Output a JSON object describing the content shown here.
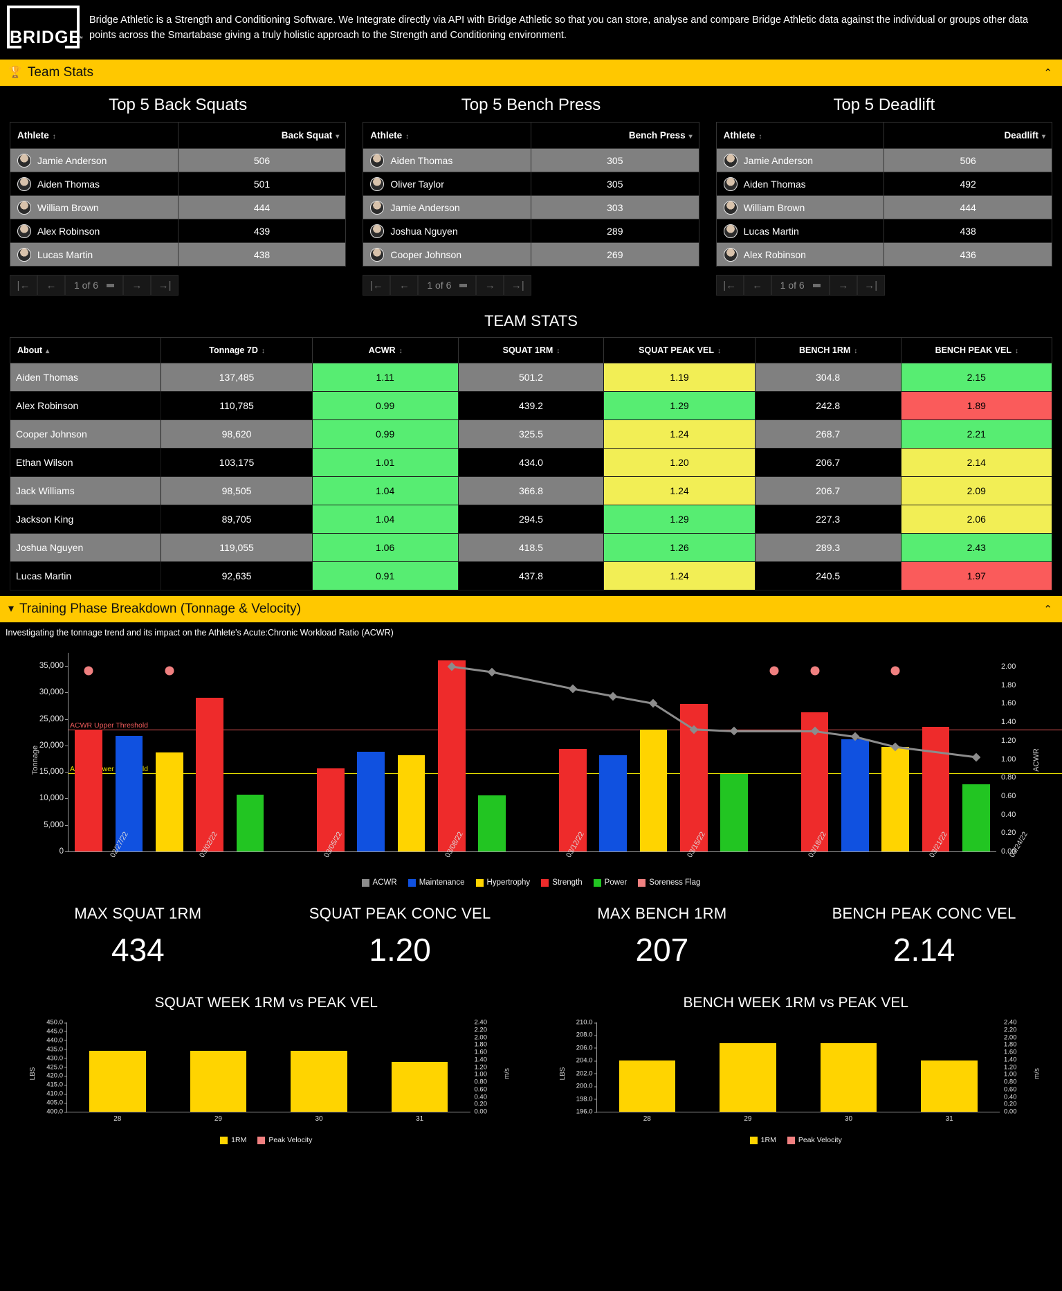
{
  "header": {
    "logo_text": "BRIDGE",
    "logo_tm": "™",
    "intro": "Bridge Athletic is a Strength and Conditioning Software. We Integrate directly via API with Bridge Athletic so that you can store, analyse and compare Bridge Athletic data against the individual or groups other data points across the Smartabase giving a truly holistic approach to the Strength and Conditioning environment."
  },
  "team_stats_section": {
    "icon": "trophy-icon",
    "title": "Team Stats",
    "collapse_caret": "⌃"
  },
  "top5": [
    {
      "title": "Top 5 Back Squats",
      "col_athlete": "Athlete",
      "col_value": "Back Squat",
      "rows": [
        {
          "athlete": "Jamie Anderson",
          "value": "506"
        },
        {
          "athlete": "Aiden Thomas",
          "value": "501"
        },
        {
          "athlete": "William Brown",
          "value": "444"
        },
        {
          "athlete": "Alex Robinson",
          "value": "439"
        },
        {
          "athlete": "Lucas Martin",
          "value": "438"
        }
      ],
      "pager": "1 of 6"
    },
    {
      "title": "Top 5 Bench Press",
      "col_athlete": "Athlete",
      "col_value": "Bench Press",
      "rows": [
        {
          "athlete": "Aiden Thomas",
          "value": "305"
        },
        {
          "athlete": "Oliver Taylor",
          "value": "305"
        },
        {
          "athlete": "Jamie Anderson",
          "value": "303"
        },
        {
          "athlete": "Joshua Nguyen",
          "value": "289"
        },
        {
          "athlete": "Cooper Johnson",
          "value": "269"
        }
      ],
      "pager": "1 of 6"
    },
    {
      "title": "Top 5 Deadlift",
      "col_athlete": "Athlete",
      "col_value": "Deadlift",
      "rows": [
        {
          "athlete": "Jamie Anderson",
          "value": "506"
        },
        {
          "athlete": "Aiden Thomas",
          "value": "492"
        },
        {
          "athlete": "William Brown",
          "value": "444"
        },
        {
          "athlete": "Lucas Martin",
          "value": "438"
        },
        {
          "athlete": "Alex Robinson",
          "value": "436"
        }
      ],
      "pager": "1 of 6"
    }
  ],
  "team_stats_table": {
    "title": "TEAM STATS",
    "columns": [
      "About",
      "Tonnage 7D",
      "ACWR",
      "SQUAT 1RM",
      "SQUAT PEAK VEL",
      "BENCH 1RM",
      "BENCH PEAK VEL"
    ],
    "rows": [
      {
        "about": "Aiden Thomas",
        "tonnage": "137,485",
        "acwr": "1.11",
        "squat_1rm": "501.2",
        "squat_vel": "1.19",
        "bench_1rm": "304.8",
        "bench_vel": "2.15",
        "colors": [
          "grey",
          "grey",
          "green",
          "grey",
          "yellow",
          "grey",
          "green"
        ]
      },
      {
        "about": "Alex Robinson",
        "tonnage": "110,785",
        "acwr": "0.99",
        "squat_1rm": "439.2",
        "squat_vel": "1.29",
        "bench_1rm": "242.8",
        "bench_vel": "1.89",
        "colors": [
          "black",
          "black",
          "green",
          "black",
          "green",
          "black",
          "red"
        ]
      },
      {
        "about": "Cooper Johnson",
        "tonnage": "98,620",
        "acwr": "0.99",
        "squat_1rm": "325.5",
        "squat_vel": "1.24",
        "bench_1rm": "268.7",
        "bench_vel": "2.21",
        "colors": [
          "grey",
          "grey",
          "green",
          "grey",
          "yellow",
          "grey",
          "green"
        ]
      },
      {
        "about": "Ethan Wilson",
        "tonnage": "103,175",
        "acwr": "1.01",
        "squat_1rm": "434.0",
        "squat_vel": "1.20",
        "bench_1rm": "206.7",
        "bench_vel": "2.14",
        "colors": [
          "black",
          "black",
          "green",
          "black",
          "yellow",
          "black",
          "yellow"
        ]
      },
      {
        "about": "Jack Williams",
        "tonnage": "98,505",
        "acwr": "1.04",
        "squat_1rm": "366.8",
        "squat_vel": "1.24",
        "bench_1rm": "206.7",
        "bench_vel": "2.09",
        "colors": [
          "grey",
          "grey",
          "green",
          "grey",
          "yellow",
          "grey",
          "yellow"
        ]
      },
      {
        "about": "Jackson King",
        "tonnage": "89,705",
        "acwr": "1.04",
        "squat_1rm": "294.5",
        "squat_vel": "1.29",
        "bench_1rm": "227.3",
        "bench_vel": "2.06",
        "colors": [
          "black",
          "black",
          "green",
          "black",
          "green",
          "black",
          "yellow"
        ]
      },
      {
        "about": "Joshua Nguyen",
        "tonnage": "119,055",
        "acwr": "1.06",
        "squat_1rm": "418.5",
        "squat_vel": "1.26",
        "bench_1rm": "289.3",
        "bench_vel": "2.43",
        "colors": [
          "grey",
          "grey",
          "green",
          "grey",
          "green",
          "grey",
          "green"
        ]
      },
      {
        "about": "Lucas Martin",
        "tonnage": "92,635",
        "acwr": "0.91",
        "squat_1rm": "437.8",
        "squat_vel": "1.24",
        "bench_1rm": "240.5",
        "bench_vel": "1.97",
        "colors": [
          "black",
          "black",
          "green",
          "black",
          "yellow",
          "black",
          "red"
        ]
      }
    ]
  },
  "training_section": {
    "icon": "filter-icon",
    "title": "Training Phase Breakdown (Tonnage & Velocity)",
    "collapse_caret": "⌃",
    "subtitle": "Investigating  the tonnage trend and its impact on the Athlete's Acute:Chronic Workload Ratio (ACWR)"
  },
  "chart_data": {
    "type": "bar",
    "title": "Training Phase Breakdown (Tonnage & Velocity)",
    "xlabel": "",
    "ylabel": "Tonnage",
    "y2label": "ACWR",
    "ylim": [
      0,
      37500
    ],
    "y2lim": [
      0,
      2.15
    ],
    "yticks": [
      "0",
      "5,000",
      "10,000",
      "15,000",
      "20,000",
      "25,000",
      "30,000",
      "35,000"
    ],
    "y2ticks": [
      "0.00",
      "0.20",
      "0.40",
      "0.60",
      "0.80",
      "1.00",
      "1.20",
      "1.40",
      "1.60",
      "1.80",
      "2.00"
    ],
    "xticks": [
      "02/27/22",
      "03/02/22",
      "03/05/22",
      "03/08/22",
      "03/12/22",
      "03/15/22",
      "03/18/22",
      "03/21/22",
      "03/24/22"
    ],
    "grid": false,
    "legend_position": "bottom",
    "legend": [
      {
        "label": "ACWR",
        "color": "#8C8C8C"
      },
      {
        "label": "Maintenance",
        "color": "#1051E0"
      },
      {
        "label": "Hypertrophy",
        "color": "#FFD400"
      },
      {
        "label": "Strength",
        "color": "#EE2B2B"
      },
      {
        "label": "Power",
        "color": "#22C522"
      },
      {
        "label": "Soreness Flag",
        "color": "#F08080"
      }
    ],
    "thresholds": [
      {
        "label": "ACWR Upper Threshold",
        "value": 23000,
        "color": "#F05B5B"
      },
      {
        "label": "ACWR Lower Threshold",
        "value": 14800,
        "color": "#E8E000"
      }
    ],
    "bars": [
      {
        "x": 0,
        "value": 23000,
        "phase": "Strength"
      },
      {
        "x": 1,
        "value": 21800,
        "phase": "Maintenance"
      },
      {
        "x": 2,
        "value": 18650,
        "phase": "Hypertrophy"
      },
      {
        "x": 3,
        "value": 29000,
        "phase": "Strength"
      },
      {
        "x": 4,
        "value": 10700,
        "phase": "Power"
      },
      {
        "x": 6,
        "value": 15700,
        "phase": "Strength"
      },
      {
        "x": 7,
        "value": 18800,
        "phase": "Maintenance"
      },
      {
        "x": 8,
        "value": 18100,
        "phase": "Hypertrophy"
      },
      {
        "x": 9,
        "value": 36100,
        "phase": "Strength"
      },
      {
        "x": 10,
        "value": 10650,
        "phase": "Power"
      },
      {
        "x": 12,
        "value": 19400,
        "phase": "Strength"
      },
      {
        "x": 13,
        "value": 18200,
        "phase": "Maintenance"
      },
      {
        "x": 14,
        "value": 23000,
        "phase": "Hypertrophy"
      },
      {
        "x": 15,
        "value": 27800,
        "phase": "Strength"
      },
      {
        "x": 16,
        "value": 14700,
        "phase": "Power"
      },
      {
        "x": 18,
        "value": 26300,
        "phase": "Strength"
      },
      {
        "x": 19,
        "value": 21200,
        "phase": "Maintenance"
      },
      {
        "x": 20,
        "value": 19700,
        "phase": "Hypertrophy"
      },
      {
        "x": 21,
        "value": 23500,
        "phase": "Strength"
      },
      {
        "x": 22,
        "value": 12700,
        "phase": "Power"
      }
    ],
    "acwr_line": [
      {
        "x": 9,
        "value": 2.0
      },
      {
        "x": 10,
        "value": 1.94
      },
      {
        "x": 12,
        "value": 1.76
      },
      {
        "x": 13,
        "value": 1.68
      },
      {
        "x": 14,
        "value": 1.6
      },
      {
        "x": 15,
        "value": 1.32
      },
      {
        "x": 16,
        "value": 1.3
      },
      {
        "x": 18,
        "value": 1.3
      },
      {
        "x": 19,
        "value": 1.24
      },
      {
        "x": 20,
        "value": 1.13
      },
      {
        "x": 22,
        "value": 1.02
      }
    ],
    "soreness_flags": [
      {
        "x": 0,
        "value": 34100
      },
      {
        "x": 2,
        "value": 34100
      },
      {
        "x": 17,
        "value": 34100
      },
      {
        "x": 18,
        "value": 34100
      },
      {
        "x": 20,
        "value": 34100
      }
    ]
  },
  "kpis": [
    {
      "label": "MAX SQUAT 1RM",
      "value": "434"
    },
    {
      "label": "SQUAT PEAK CONC VEL",
      "value": "1.20"
    },
    {
      "label": "MAX BENCH 1RM",
      "value": "207"
    },
    {
      "label": "BENCH PEAK CONC VEL",
      "value": "2.14"
    }
  ],
  "small_charts": [
    {
      "type": "bar",
      "title": "SQUAT WEEK 1RM vs PEAK VEL",
      "ylabel": "LBS",
      "y2label": "m/s",
      "ylim": [
        400.0,
        450.0
      ],
      "y2lim": [
        0.0,
        2.4
      ],
      "yticks": [
        "400.0",
        "405.0",
        "410.0",
        "415.0",
        "420.0",
        "425.0",
        "430.0",
        "435.0",
        "440.0",
        "445.0",
        "450.0"
      ],
      "y2ticks": [
        "0.00",
        "0.20",
        "0.40",
        "0.60",
        "0.80",
        "1.00",
        "1.20",
        "1.40",
        "1.60",
        "1.80",
        "2.00",
        "2.20",
        "2.40"
      ],
      "categories": [
        "28",
        "29",
        "30",
        "31"
      ],
      "series": [
        {
          "name": "1RM",
          "color": "#FFD400",
          "values": [
            434.0,
            434.0,
            434.0,
            428.0
          ]
        },
        {
          "name": "Peak Velocity",
          "color": "#F08080",
          "values": []
        }
      ],
      "legend": [
        {
          "label": "1RM",
          "color": "#FFD400"
        },
        {
          "label": "Peak Velocity",
          "color": "#F08080"
        }
      ]
    },
    {
      "type": "bar",
      "title": "BENCH WEEK 1RM vs PEAK VEL",
      "ylabel": "LBS",
      "y2label": "m/s",
      "ylim": [
        196.0,
        210.0
      ],
      "y2lim": [
        0.0,
        2.4
      ],
      "yticks": [
        "196.0",
        "198.0",
        "200.0",
        "202.0",
        "204.0",
        "206.0",
        "208.0",
        "210.0"
      ],
      "y2ticks": [
        "0.00",
        "0.20",
        "0.40",
        "0.60",
        "0.80",
        "1.00",
        "1.20",
        "1.40",
        "1.60",
        "1.80",
        "2.00",
        "2.20",
        "2.40"
      ],
      "categories": [
        "28",
        "29",
        "30",
        "31"
      ],
      "series": [
        {
          "name": "1RM",
          "color": "#FFD400",
          "values": [
            204.0,
            206.7,
            206.7,
            204.0
          ]
        },
        {
          "name": "Peak Velocity",
          "color": "#F08080",
          "values": []
        }
      ],
      "legend": [
        {
          "label": "1RM",
          "color": "#FFD400"
        },
        {
          "label": "Peak Velocity",
          "color": "#F08080"
        }
      ]
    }
  ]
}
